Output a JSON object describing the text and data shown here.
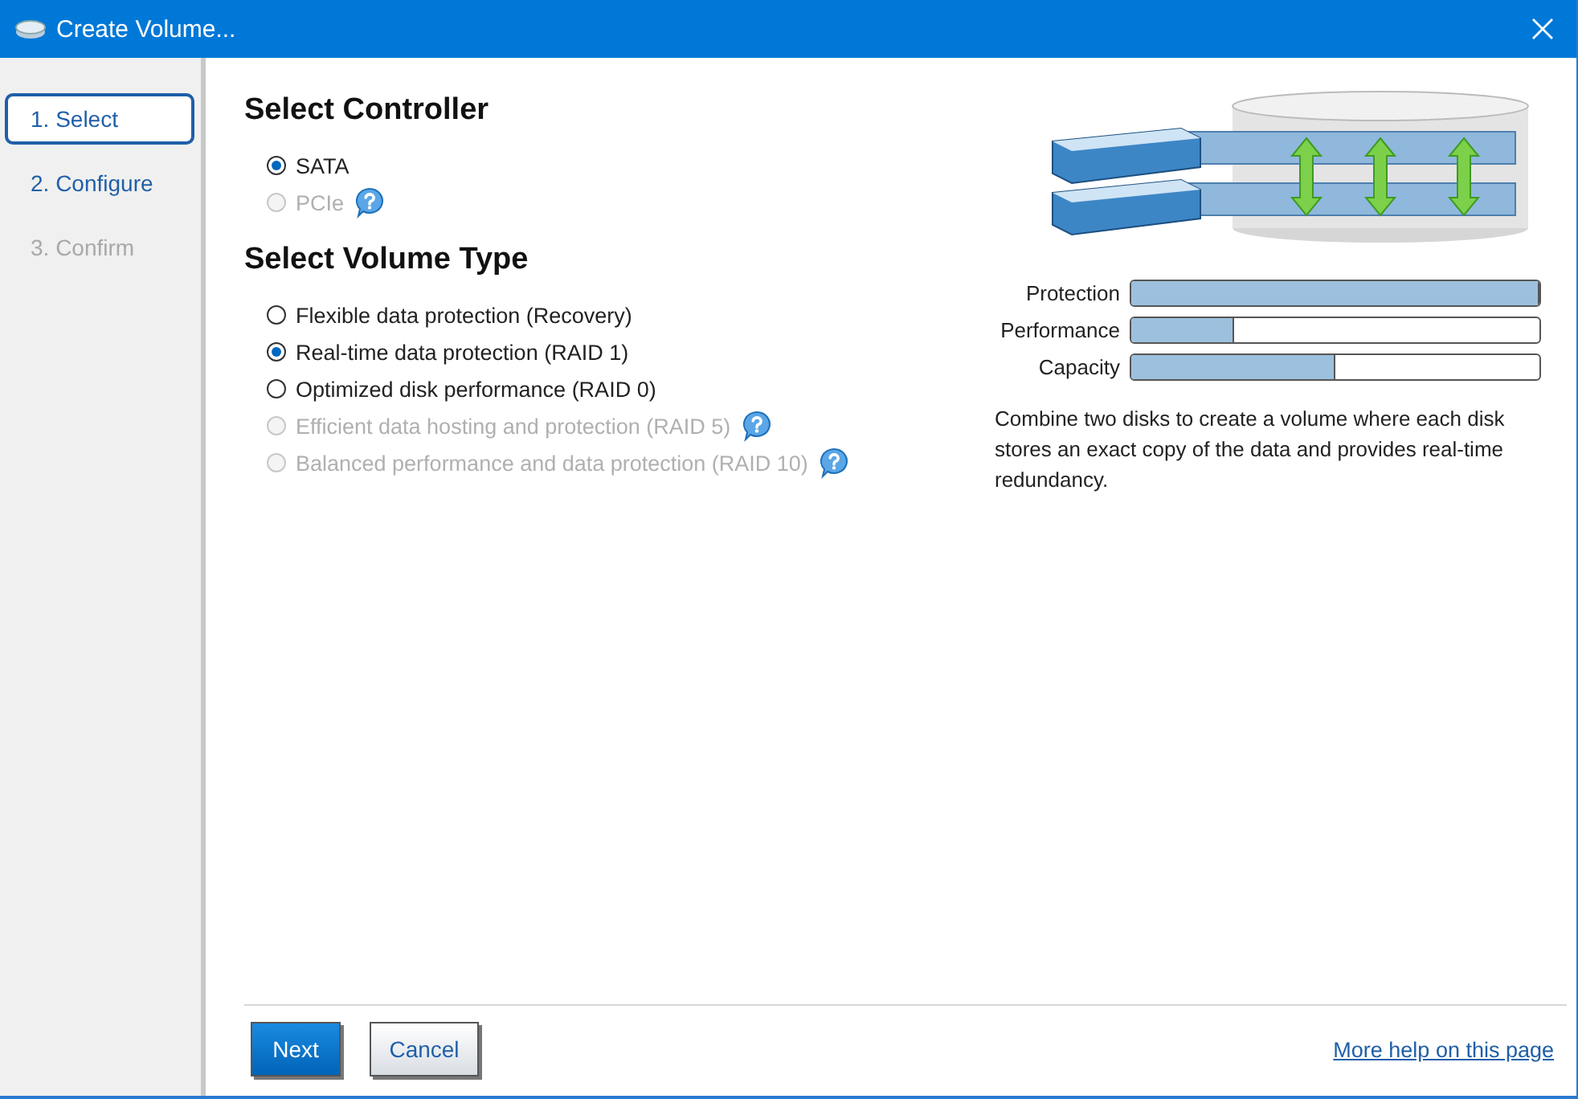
{
  "window": {
    "title": "Create Volume..."
  },
  "steps": [
    {
      "label": "1. Select",
      "selected": true,
      "disabled": false
    },
    {
      "label": "2. Configure",
      "selected": false,
      "disabled": false
    },
    {
      "label": "3. Confirm",
      "selected": false,
      "disabled": true
    }
  ],
  "controller": {
    "heading": "Select Controller",
    "options": [
      {
        "label": "SATA",
        "selected": true,
        "disabled": false,
        "help": false
      },
      {
        "label": "PCIe",
        "selected": false,
        "disabled": true,
        "help": true
      }
    ]
  },
  "volume_type": {
    "heading": "Select Volume Type",
    "options": [
      {
        "label": "Flexible data protection (Recovery)",
        "selected": false,
        "disabled": false,
        "help": false
      },
      {
        "label": "Real-time data protection (RAID 1)",
        "selected": true,
        "disabled": false,
        "help": false
      },
      {
        "label": "Optimized disk performance (RAID 0)",
        "selected": false,
        "disabled": false,
        "help": false
      },
      {
        "label": "Efficient data hosting and protection (RAID 5)",
        "selected": false,
        "disabled": true,
        "help": true
      },
      {
        "label": "Balanced performance and data protection (RAID 10)",
        "selected": false,
        "disabled": true,
        "help": true
      }
    ]
  },
  "meters": [
    {
      "label": "Protection",
      "level": 1.0
    },
    {
      "label": "Performance",
      "level": 0.25
    },
    {
      "label": "Capacity",
      "level": 0.5
    }
  ],
  "description": "Combine two disks to create a volume where each disk stores an exact copy of the data and provides real-time redundancy.",
  "buttons": [
    {
      "label": "Next",
      "kind": "primary"
    },
    {
      "label": "Cancel",
      "kind": "secondary"
    }
  ],
  "help_link": "More help on this page"
}
